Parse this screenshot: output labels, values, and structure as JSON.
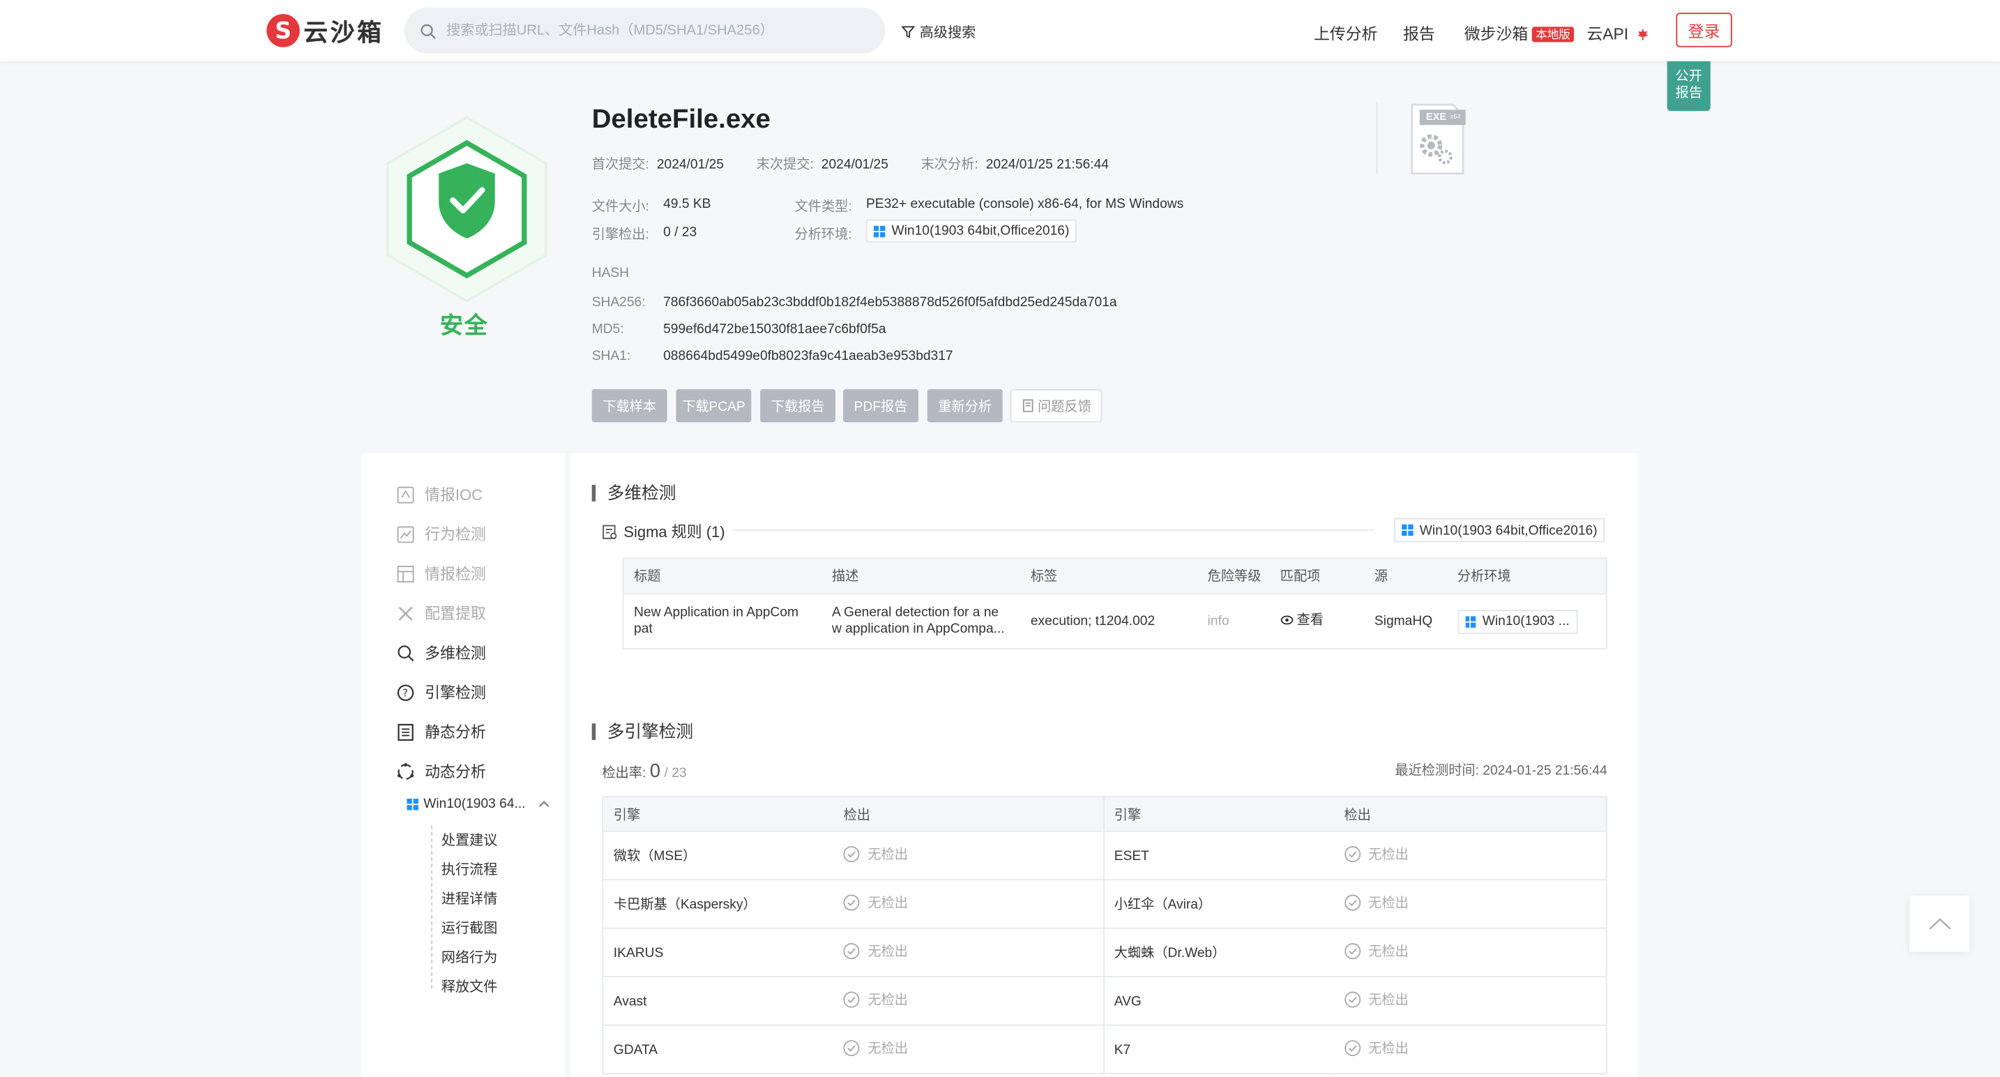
{
  "header": {
    "logo_mark": "S",
    "logo_text": "云沙箱",
    "search_placeholder": "搜索或扫描URL、文件Hash（MD5/SHA1/SHA256）",
    "advanced_search": "高级搜索",
    "nav": {
      "upload": "上传分析",
      "report": "报告",
      "micro_sandbox": "微步沙箱",
      "local_badge": "本地版",
      "cloud_api": "云API"
    },
    "login": "登录",
    "public_report_line1": "公开",
    "public_report_line2": "报告"
  },
  "summary": {
    "verdict": "安全",
    "file_name": "DeleteFile.exe",
    "first_submit_label": "首次提交:",
    "first_submit": "2024/01/25",
    "last_submit_label": "末次提交:",
    "last_submit": "2024/01/25",
    "last_analysis_label": "末次分析:",
    "last_analysis": "2024/01/25 21:56:44",
    "file_size_label": "文件大小:",
    "file_size": "49.5 KB",
    "file_type_label": "文件类型:",
    "file_type": "PE32+ executable (console) x86-64, for MS Windows",
    "engine_detect_label": "引擎检出:",
    "engine_detect": "0 / 23",
    "env_label": "分析环境:",
    "env": "Win10(1903 64bit,Office2016)",
    "hash_label": "HASH",
    "sha256_label": "SHA256:",
    "sha256": "786f3660ab05ab23c3bddf0b182f4eb5388878d526f0f5afdbd25ed245da701a",
    "md5_label": "MD5:",
    "md5": "599ef6d472be15030f81aee7c6bf0f5a",
    "sha1_label": "SHA1:",
    "sha1": "088664bd5499e0fb8023fa9c41aeab3e953bd317",
    "exe_badge": "EXE",
    "exe_badge_sub": "x64",
    "verdict_color": "#36b35a"
  },
  "actions": {
    "download_sample": "下载样本",
    "download_pcap": "下载PCAP",
    "download_report": "下载报告",
    "pdf_report": "PDF报告",
    "reanalyze": "重新分析",
    "feedback": "问题反馈"
  },
  "sidebar": {
    "items": [
      {
        "label": "情报IOC",
        "icon": "intel-ioc-icon"
      },
      {
        "label": "行为检测",
        "icon": "behavior-icon"
      },
      {
        "label": "情报检测",
        "icon": "intel-detect-icon"
      },
      {
        "label": "配置提取",
        "icon": "config-extract-icon"
      },
      {
        "label": "多维检测",
        "icon": "multi-detect-icon"
      },
      {
        "label": "引擎检测",
        "icon": "engine-detect-icon"
      },
      {
        "label": "静态分析",
        "icon": "static-analysis-icon"
      },
      {
        "label": "动态分析",
        "icon": "dynamic-analysis-icon"
      }
    ],
    "env": "Win10(1903 64...",
    "sub_items": [
      "处置建议",
      "执行流程",
      "进程详情",
      "运行截图",
      "网络行为",
      "释放文件"
    ]
  },
  "multi_detect": {
    "title": "多维检测",
    "sigma_label": "Sigma 规则 (1)",
    "env": "Win10(1903 64bit,Office2016)",
    "columns": [
      "标题",
      "描述",
      "标签",
      "危险等级",
      "匹配项",
      "源",
      "分析环境"
    ],
    "rows": [
      {
        "title_l1": "New Application in AppCom",
        "title_l2": "pat",
        "desc_l1": "A General detection for a ne",
        "desc_l2": "w application in AppCompa...",
        "tags": "execution; t1204.002",
        "level": "info",
        "match": "查看",
        "source": "SigmaHQ",
        "env": "Win10(1903 ..."
      }
    ]
  },
  "engine_detect": {
    "title": "多引擎检测",
    "rate_label": "检出率:",
    "rate_value": "0",
    "rate_total": "/ 23",
    "last_time_label": "最近检测时间:",
    "last_time": "2024-01-25 21:56:44",
    "columns": [
      "引擎",
      "检出",
      "引擎",
      "检出"
    ],
    "rows": [
      {
        "e1": "微软（MSE）",
        "r1": "无检出",
        "e2": "ESET",
        "r2": "无检出"
      },
      {
        "e1": "卡巴斯基（Kaspersky）",
        "r1": "无检出",
        "e2": "小红伞（Avira）",
        "r2": "无检出"
      },
      {
        "e1": "IKARUS",
        "r1": "无检出",
        "e2": "大蜘蛛（Dr.Web）",
        "r2": "无检出"
      },
      {
        "e1": "Avast",
        "r1": "无检出",
        "e2": "AVG",
        "r2": "无检出"
      },
      {
        "e1": "GDATA",
        "r1": "无检出",
        "e2": "K7",
        "r2": "无检出"
      }
    ]
  }
}
